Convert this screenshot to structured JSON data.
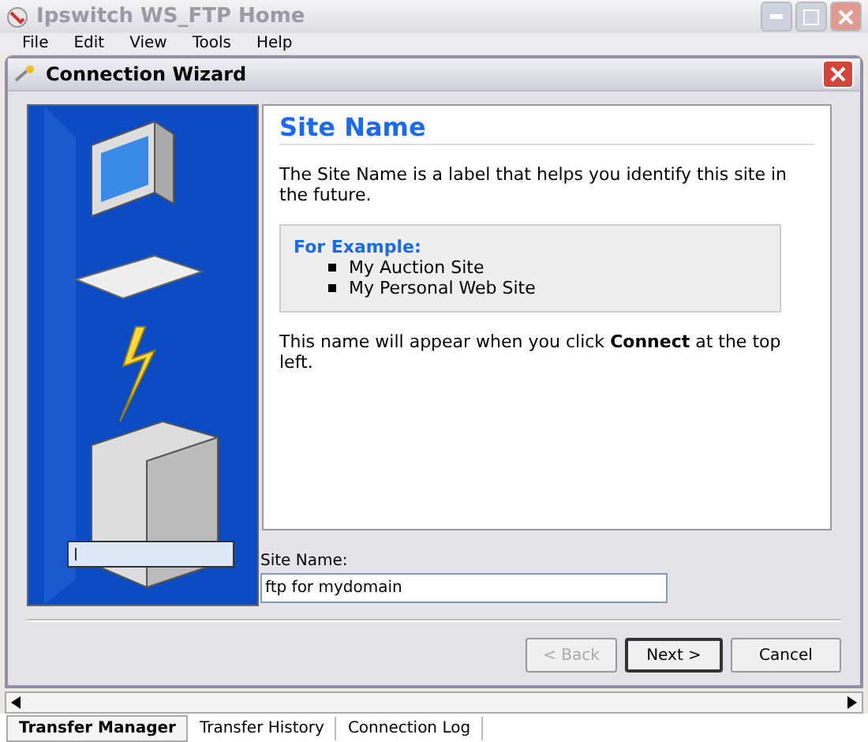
{
  "app_window": {
    "title": "Ipswitch WS_FTP Home"
  },
  "menu": [
    "File",
    "Edit",
    "View",
    "Tools",
    "Help"
  ],
  "dialog": {
    "title": "Connection Wizard",
    "heading": "Site Name",
    "intro": "The Site Name is a label that helps you identify this site in the future.",
    "example_title": "For Example:",
    "examples": [
      "My Auction Site",
      "My Personal Web Site"
    ],
    "note": "This name will appear when you click **Connect** at the top left.",
    "field_label": "Site Name:",
    "field_value": "ftp for mydomain",
    "buttons": [
      {
        "label": "< Back",
        "disabled": true,
        "default": false
      },
      {
        "label": "Next >",
        "disabled": false,
        "default": true
      },
      {
        "label": "Cancel",
        "disabled": false,
        "default": false
      }
    ]
  },
  "bottom_tabs": [
    {
      "label": "Transfer Manager",
      "selected": true
    },
    {
      "label": "Transfer History",
      "selected": false
    },
    {
      "label": "Connection Log",
      "selected": false
    }
  ]
}
